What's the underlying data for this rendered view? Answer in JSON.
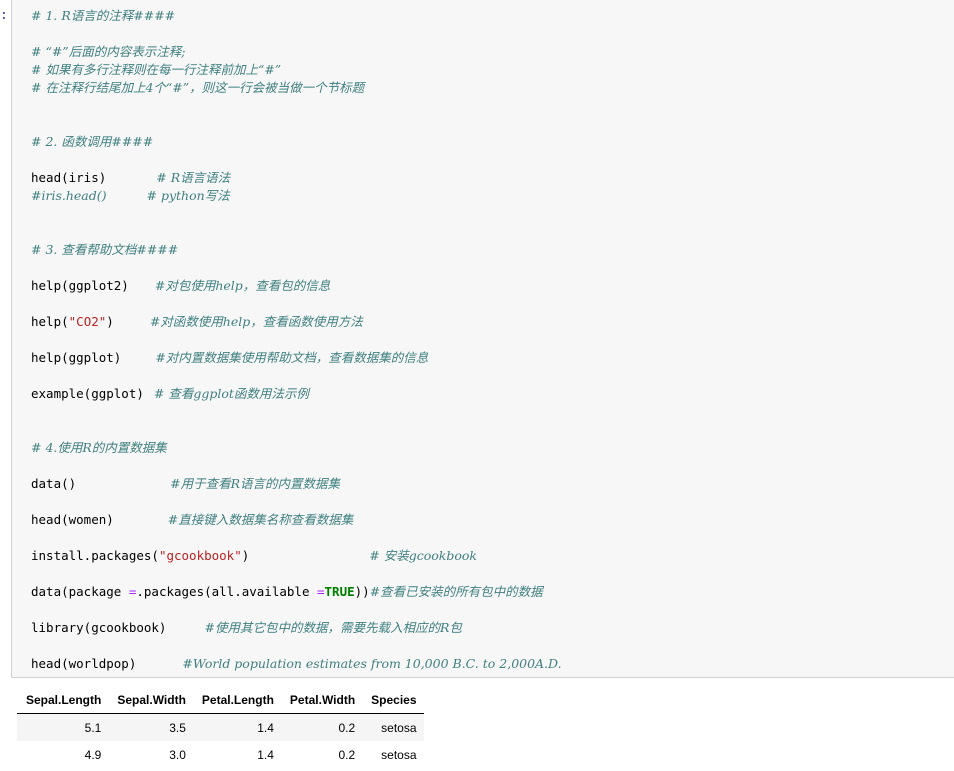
{
  "prompt": ":",
  "code": {
    "l1_comment": "# 1. R语言的注释####",
    "l2_comment": "# “#”后面的内容表示注释;",
    "l3_comment": "# 如果有多行注释则在每一行注释前加上“#”",
    "l4_comment": "# 在注释行结尾加上4个“#”，则这一行会被当做一个节标题",
    "l5_comment": "# 2. 函数调用####",
    "l6_code": "head(iris)",
    "l6_comment": "# R语言语法",
    "l7_comment": "#iris.head()",
    "l7_comment2": "# python写法",
    "l8_comment": "# 3. 查看帮助文档####",
    "l9_code": "help(ggplot2)",
    "l9_comment": "#对包使用help，查看包的信息",
    "l10_code_a": "help(",
    "l10_string": "\"CO2\"",
    "l10_code_b": ")",
    "l10_comment": "#对函数使用help，查看函数使用方法",
    "l11_code": "help(ggplot)",
    "l11_comment": "#对内置数据集使用帮助文档，查看数据集的信息",
    "l12_code": "example(ggplot)",
    "l12_comment": "# 查看ggplot函数用法示例",
    "l13_comment": "# 4.使用R的内置数据集",
    "l14_code": "data()",
    "l14_comment": "#用于查看R语言的内置数据集",
    "l15_code": "head(women)",
    "l15_comment": "#直接键入数据集名称查看数据集",
    "l16_code_a": "install.packages(",
    "l16_string": "\"gcookbook\"",
    "l16_code_b": ")",
    "l16_comment": "# 安装gcookbook",
    "l17_code_a": "data(package ",
    "l17_op1": "=",
    "l17_code_b": ".packages(all.available ",
    "l17_op2": "=",
    "l17_kw": "TRUE",
    "l17_code_c": "))",
    "l17_comment": "#查看已安装的所有包中的数据",
    "l18_code": "library(gcookbook)",
    "l18_comment": "#使用其它包中的数据，需要先载入相应的R包",
    "l19_code": "head(worldpop)",
    "l19_comment": "#World population estimates from 10,000 B.C. to 2,000A.D."
  },
  "output_table": {
    "headers": [
      "Sepal.Length",
      "Sepal.Width",
      "Petal.Length",
      "Petal.Width",
      "Species"
    ],
    "rows": [
      [
        "5.1",
        "3.5",
        "1.4",
        "0.2",
        "setosa"
      ],
      [
        "4.9",
        "3.0",
        "1.4",
        "0.2",
        "setosa"
      ]
    ]
  }
}
